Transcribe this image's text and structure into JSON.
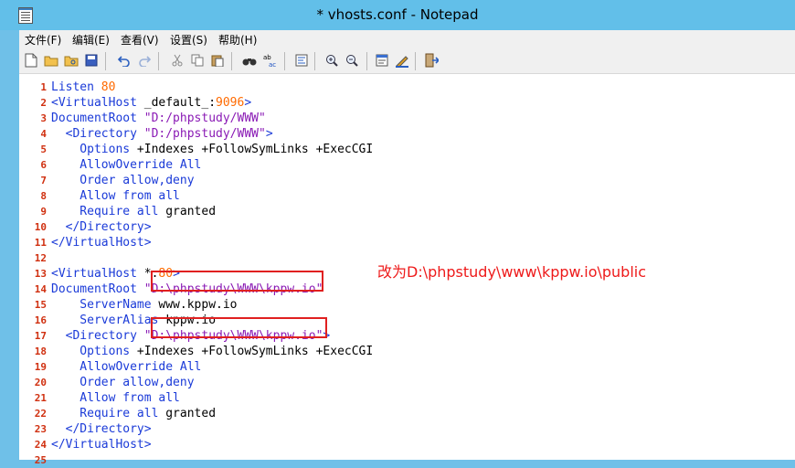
{
  "window": {
    "title": "* vhosts.conf - Notepad"
  },
  "menu": [
    {
      "id": "file",
      "label": "文件(F)"
    },
    {
      "id": "edit",
      "label": "编辑(E)"
    },
    {
      "id": "view",
      "label": "查看(V)"
    },
    {
      "id": "settings",
      "label": "设置(S)"
    },
    {
      "id": "help",
      "label": "帮助(H)"
    }
  ],
  "toolbar": [
    "new-file-icon",
    "open-file-icon",
    "open-folder-icon",
    "save-icon",
    "undo-icon",
    "redo-icon",
    "cut-icon",
    "copy-icon",
    "paste-icon",
    "find-icon",
    "replace-icon",
    "word-wrap-icon",
    "zoom-in-icon",
    "zoom-out-icon",
    "properties-icon",
    "edit-scheme-icon",
    "exit-icon"
  ],
  "lines": [
    {
      "n": "1",
      "t": [
        [
          "k",
          "Listen "
        ],
        [
          "n",
          "80"
        ]
      ]
    },
    {
      "n": "2",
      "t": [
        [
          "k",
          "<VirtualHost "
        ],
        [
          "p",
          "_default_:"
        ],
        [
          "n",
          "9096"
        ],
        [
          "k",
          ">"
        ]
      ]
    },
    {
      "n": "3",
      "t": [
        [
          "k",
          "DocumentRoot "
        ],
        [
          "s",
          "\"D:/phpstudy/WWW\""
        ]
      ]
    },
    {
      "n": "4",
      "t": [
        [
          "k",
          "  <Directory "
        ],
        [
          "s",
          "\"D:/phpstudy/WWW\""
        ],
        [
          "k",
          ">"
        ]
      ]
    },
    {
      "n": "5",
      "t": [
        [
          "k",
          "    Options "
        ],
        [
          "p",
          "+Indexes +FollowSymLinks +ExecCGI"
        ]
      ]
    },
    {
      "n": "6",
      "t": [
        [
          "k",
          "    AllowOverride All"
        ]
      ]
    },
    {
      "n": "7",
      "t": [
        [
          "k",
          "    Order allow,deny"
        ]
      ]
    },
    {
      "n": "8",
      "t": [
        [
          "k",
          "    Allow from all"
        ]
      ]
    },
    {
      "n": "9",
      "t": [
        [
          "k",
          "    Require all "
        ],
        [
          "p",
          "granted"
        ]
      ]
    },
    {
      "n": "10",
      "t": [
        [
          "k",
          "  </Directory>"
        ]
      ]
    },
    {
      "n": "11",
      "t": [
        [
          "k",
          "</VirtualHost>"
        ]
      ]
    },
    {
      "n": "12",
      "t": []
    },
    {
      "n": "13",
      "t": [
        [
          "k",
          "<VirtualHost "
        ],
        [
          "p",
          "*:"
        ],
        [
          "n",
          "80"
        ],
        [
          "k",
          ">"
        ]
      ]
    },
    {
      "n": "14",
      "t": [
        [
          "k",
          "DocumentRoot "
        ],
        [
          "s",
          "\"D:\\phpstudy\\WWW\\kppw.io\""
        ]
      ]
    },
    {
      "n": "15",
      "t": [
        [
          "k",
          "    ServerName "
        ],
        [
          "p",
          "www.kppw.io"
        ]
      ]
    },
    {
      "n": "16",
      "t": [
        [
          "k",
          "    ServerAlias "
        ],
        [
          "p",
          "kppw.io"
        ]
      ]
    },
    {
      "n": "17",
      "t": [
        [
          "k",
          "  <Directory "
        ],
        [
          "s",
          "\"D:\\phpstudy\\WWW\\kppw.io\""
        ],
        [
          "k",
          ">"
        ]
      ]
    },
    {
      "n": "18",
      "t": [
        [
          "k",
          "    Options "
        ],
        [
          "p",
          "+Indexes +FollowSymLinks +ExecCGI"
        ]
      ]
    },
    {
      "n": "19",
      "t": [
        [
          "k",
          "    AllowOverride All"
        ]
      ]
    },
    {
      "n": "20",
      "t": [
        [
          "k",
          "    Order allow,deny"
        ]
      ]
    },
    {
      "n": "21",
      "t": [
        [
          "k",
          "    Allow from all"
        ]
      ]
    },
    {
      "n": "22",
      "t": [
        [
          "k",
          "    Require all "
        ],
        [
          "p",
          "granted"
        ]
      ]
    },
    {
      "n": "23",
      "t": [
        [
          "k",
          "  </Directory>"
        ]
      ]
    },
    {
      "n": "24",
      "t": [
        [
          "k",
          "</VirtualHost>"
        ]
      ]
    },
    {
      "n": "25",
      "t": []
    }
  ],
  "annotation": "改为D:\\phpstudy\\www\\kppw.io\\public"
}
